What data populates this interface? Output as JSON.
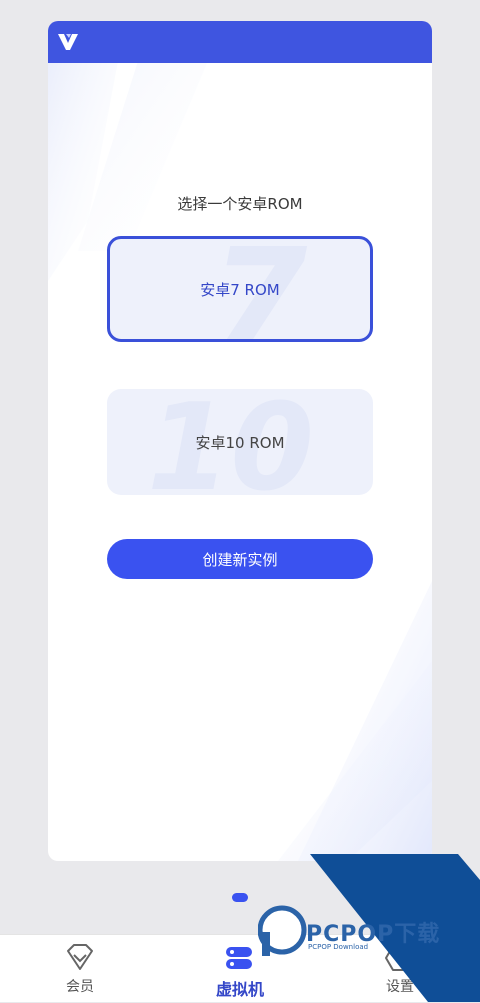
{
  "card": {
    "select_title": "选择一个安卓ROM",
    "options": [
      {
        "label": "安卓7 ROM",
        "big_number": "7",
        "selected": true
      },
      {
        "label": "安卓10 ROM",
        "big_number": "10",
        "selected": false
      }
    ],
    "create_button": "创建新实例"
  },
  "bottom_nav": {
    "items": [
      {
        "label": "会员",
        "icon": "diamond-icon"
      },
      {
        "label": "虚拟机",
        "icon": "server-icon"
      },
      {
        "label": "设置",
        "icon": "hexagon-gear-icon"
      }
    ],
    "active_index": 1
  },
  "watermark": {
    "text": "PCPOP下载",
    "subtext": "PCPOP Download"
  },
  "colors": {
    "accent": "#3a52f0",
    "header": "#3f55e0",
    "option_bg": "#eef1fb",
    "watermark": "#2b63a8"
  }
}
